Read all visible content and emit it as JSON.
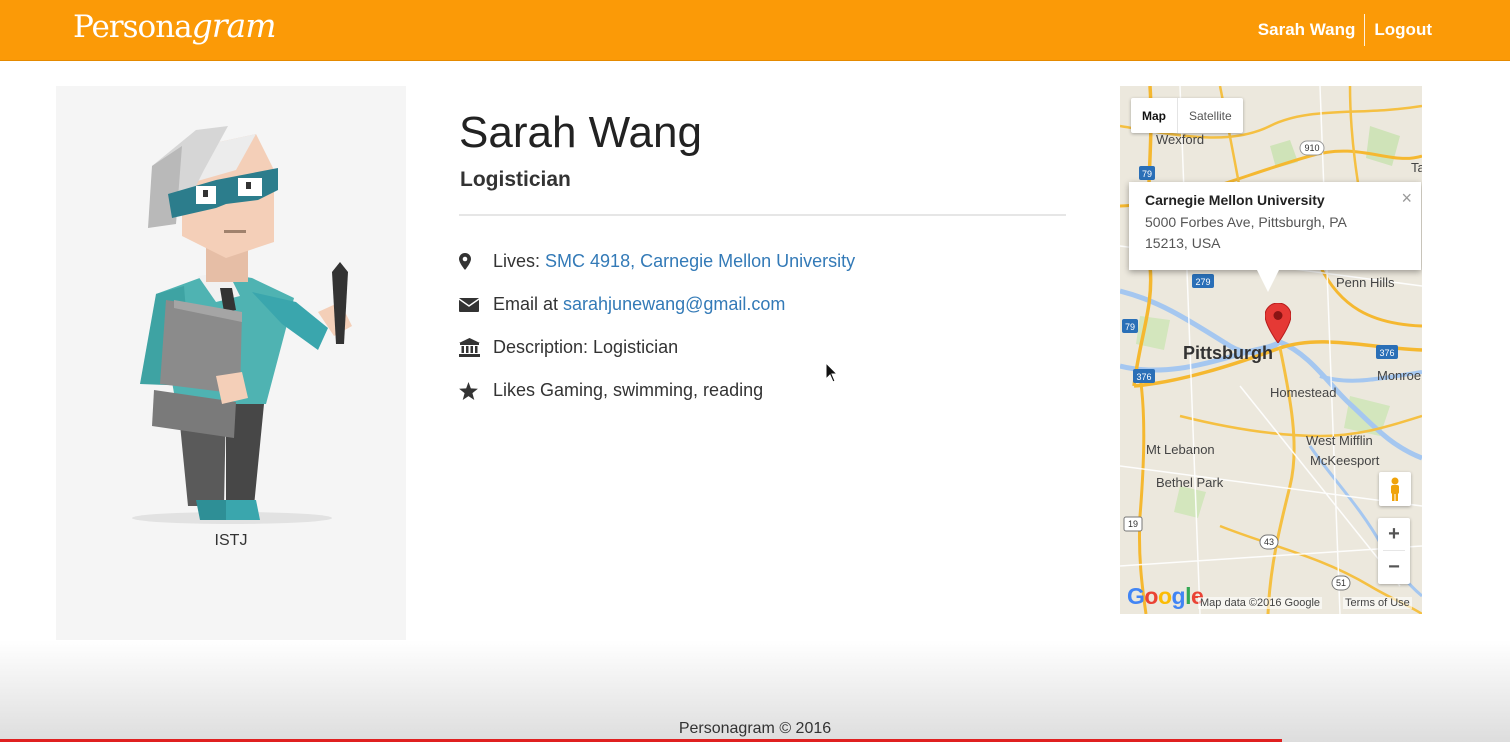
{
  "navbar": {
    "brand_part1": "Persona",
    "brand_part2": "gram",
    "user_name": "Sarah Wang",
    "logout_label": "Logout",
    "color": "#fb9a07"
  },
  "avatar": {
    "personality_type": "ISTJ",
    "illustration": "man-with-glasses-holding-folder-and-pen"
  },
  "profile": {
    "name": "Sarah Wang",
    "title": "Logistician",
    "lives_label": "Lives: ",
    "lives_value": "SMC 4918, Carnegie Mellon University",
    "email_label": "Email at ",
    "email_value": "sarahjunewang@gmail.com",
    "description": "Description: Logistician",
    "likes": "Likes Gaming, swimming, reading",
    "icons": [
      "map-marker-icon",
      "envelope-icon",
      "bank-icon",
      "star-icon"
    ],
    "link_color": "#337ab7"
  },
  "map": {
    "tab_map": "Map",
    "tab_satellite": "Satellite",
    "info_title": "Carnegie Mellon University",
    "info_address_line1": "5000 Forbes Ave, Pittsburgh, PA",
    "info_address_line2": "15213, USA",
    "info_close": "×",
    "labels": {
      "wexford": "Wexford",
      "ta": "Ta",
      "penn_hills": "Penn Hills",
      "pittsburgh": "Pittsburgh",
      "monroe": "Monroe",
      "homestead": "Homestead",
      "mt_lebanon": "Mt Lebanon",
      "west_mifflin": "West Mifflin",
      "mckeesport": "McKeesport",
      "bethel_park": "Bethel Park"
    },
    "shields": {
      "s910": "910",
      "s79a": "79",
      "s279": "279",
      "s79b": "79",
      "s376a": "376",
      "s376b": "376",
      "s19": "19",
      "s43": "43",
      "s51": "51"
    },
    "zoom_in": "+",
    "zoom_out": "−",
    "google": "Google",
    "attribution": "Map data ©2016 Google",
    "terms": "Terms of Use"
  },
  "footer": {
    "text": "Personagram © 2016"
  }
}
